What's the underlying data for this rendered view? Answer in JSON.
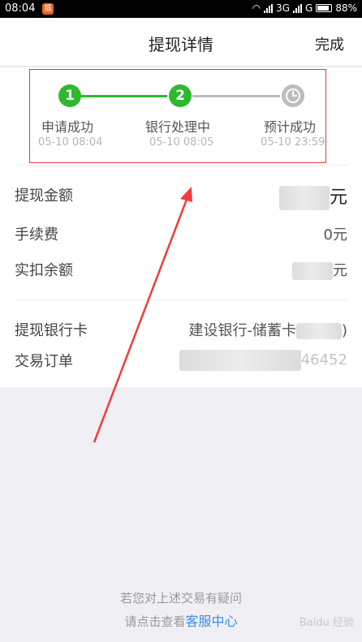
{
  "status_bar": {
    "time": "08:04",
    "app_badge": "猫",
    "network": "3G",
    "carrier_g": "G",
    "battery_pct": "88%",
    "battery_level": 0.88
  },
  "navbar": {
    "title": "提现详情",
    "done_label": "完成"
  },
  "progress": {
    "steps": [
      {
        "number": "1",
        "label": "申请成功",
        "time": "05-10 08:04",
        "status": "done"
      },
      {
        "number": "2",
        "label": "银行处理中",
        "time": "05-10 08:05",
        "status": "done"
      },
      {
        "number": "",
        "label": "预计成功",
        "time": "05-10 23:59",
        "status": "pending"
      }
    ]
  },
  "details": {
    "amount": {
      "label": "提现金额",
      "unit": "元"
    },
    "fee": {
      "label": "手续费",
      "value": "0元"
    },
    "actual": {
      "label": "实扣余额",
      "unit": "元"
    },
    "bank_card": {
      "label": "提现银行卡",
      "value_prefix": "建设银行-储蓄卡",
      "value_suffix": ")"
    },
    "order": {
      "label": "交易订单",
      "value_suffix": "46452"
    }
  },
  "footer": {
    "line1": "若您对上述交易有疑问",
    "line2_prefix": "请点击查看",
    "link": "客服中心"
  },
  "watermark": "Baidu 经验",
  "colors": {
    "green": "#2eb82e",
    "gray": "#bdbdbd",
    "highlight_red": "#e23b3b",
    "link_blue": "#3a8ee6"
  }
}
